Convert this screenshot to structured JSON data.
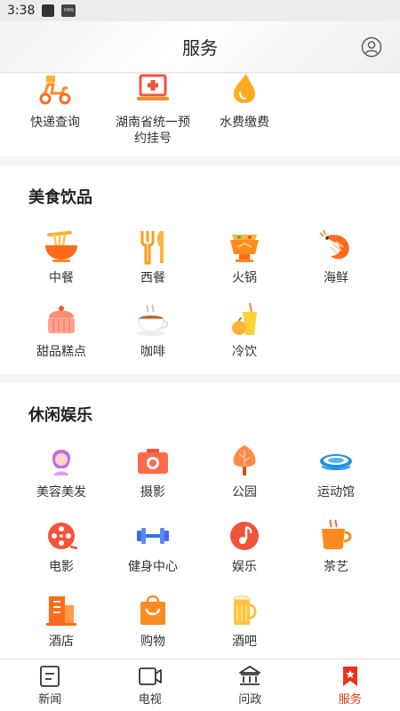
{
  "status_bar": {
    "time": "3:38"
  },
  "header": {
    "title": "服务"
  },
  "section_top": {
    "items": [
      {
        "label": "快递查询",
        "icon": "scooter-icon"
      },
      {
        "label": "湖南省统一预约挂号",
        "icon": "hospital-laptop-icon"
      },
      {
        "label": "水费缴费",
        "icon": "water-drop-icon"
      }
    ]
  },
  "section_food": {
    "title": "美食饮品",
    "items": [
      {
        "label": "中餐",
        "icon": "noodle-bowl-icon"
      },
      {
        "label": "西餐",
        "icon": "fork-knife-icon"
      },
      {
        "label": "火锅",
        "icon": "hotpot-icon"
      },
      {
        "label": "海鲜",
        "icon": "shrimp-icon"
      },
      {
        "label": "甜品糕点",
        "icon": "cake-icon"
      },
      {
        "label": "咖啡",
        "icon": "coffee-cup-icon"
      },
      {
        "label": "冷饮",
        "icon": "cold-drink-icon"
      }
    ]
  },
  "section_leisure": {
    "title": "休闲娱乐",
    "items": [
      {
        "label": "美容美发",
        "icon": "beauty-hair-icon"
      },
      {
        "label": "摄影",
        "icon": "camera-icon"
      },
      {
        "label": "公园",
        "icon": "tree-icon"
      },
      {
        "label": "运动馆",
        "icon": "stadium-icon"
      },
      {
        "label": "电影",
        "icon": "film-reel-icon"
      },
      {
        "label": "健身中心",
        "icon": "dumbbell-icon"
      },
      {
        "label": "娱乐",
        "icon": "music-note-icon"
      },
      {
        "label": "茶艺",
        "icon": "tea-cup-icon"
      },
      {
        "label": "酒店",
        "icon": "hotel-building-icon"
      },
      {
        "label": "购物",
        "icon": "shopping-bag-icon"
      },
      {
        "label": "酒吧",
        "icon": "beer-mug-icon"
      }
    ]
  },
  "tabbar": {
    "tabs": [
      {
        "label": "新闻",
        "icon": "news-icon",
        "active": false
      },
      {
        "label": "电视",
        "icon": "tv-camera-icon",
        "active": false
      },
      {
        "label": "问政",
        "icon": "government-building-icon",
        "active": false
      },
      {
        "label": "服务",
        "icon": "service-flag-icon",
        "active": true
      }
    ],
    "active_color": "#e8341c"
  },
  "colors": {
    "accent_orange": "#ff8a1f",
    "accent_red": "#e8341c",
    "icon_blue": "#3a6ee8"
  }
}
